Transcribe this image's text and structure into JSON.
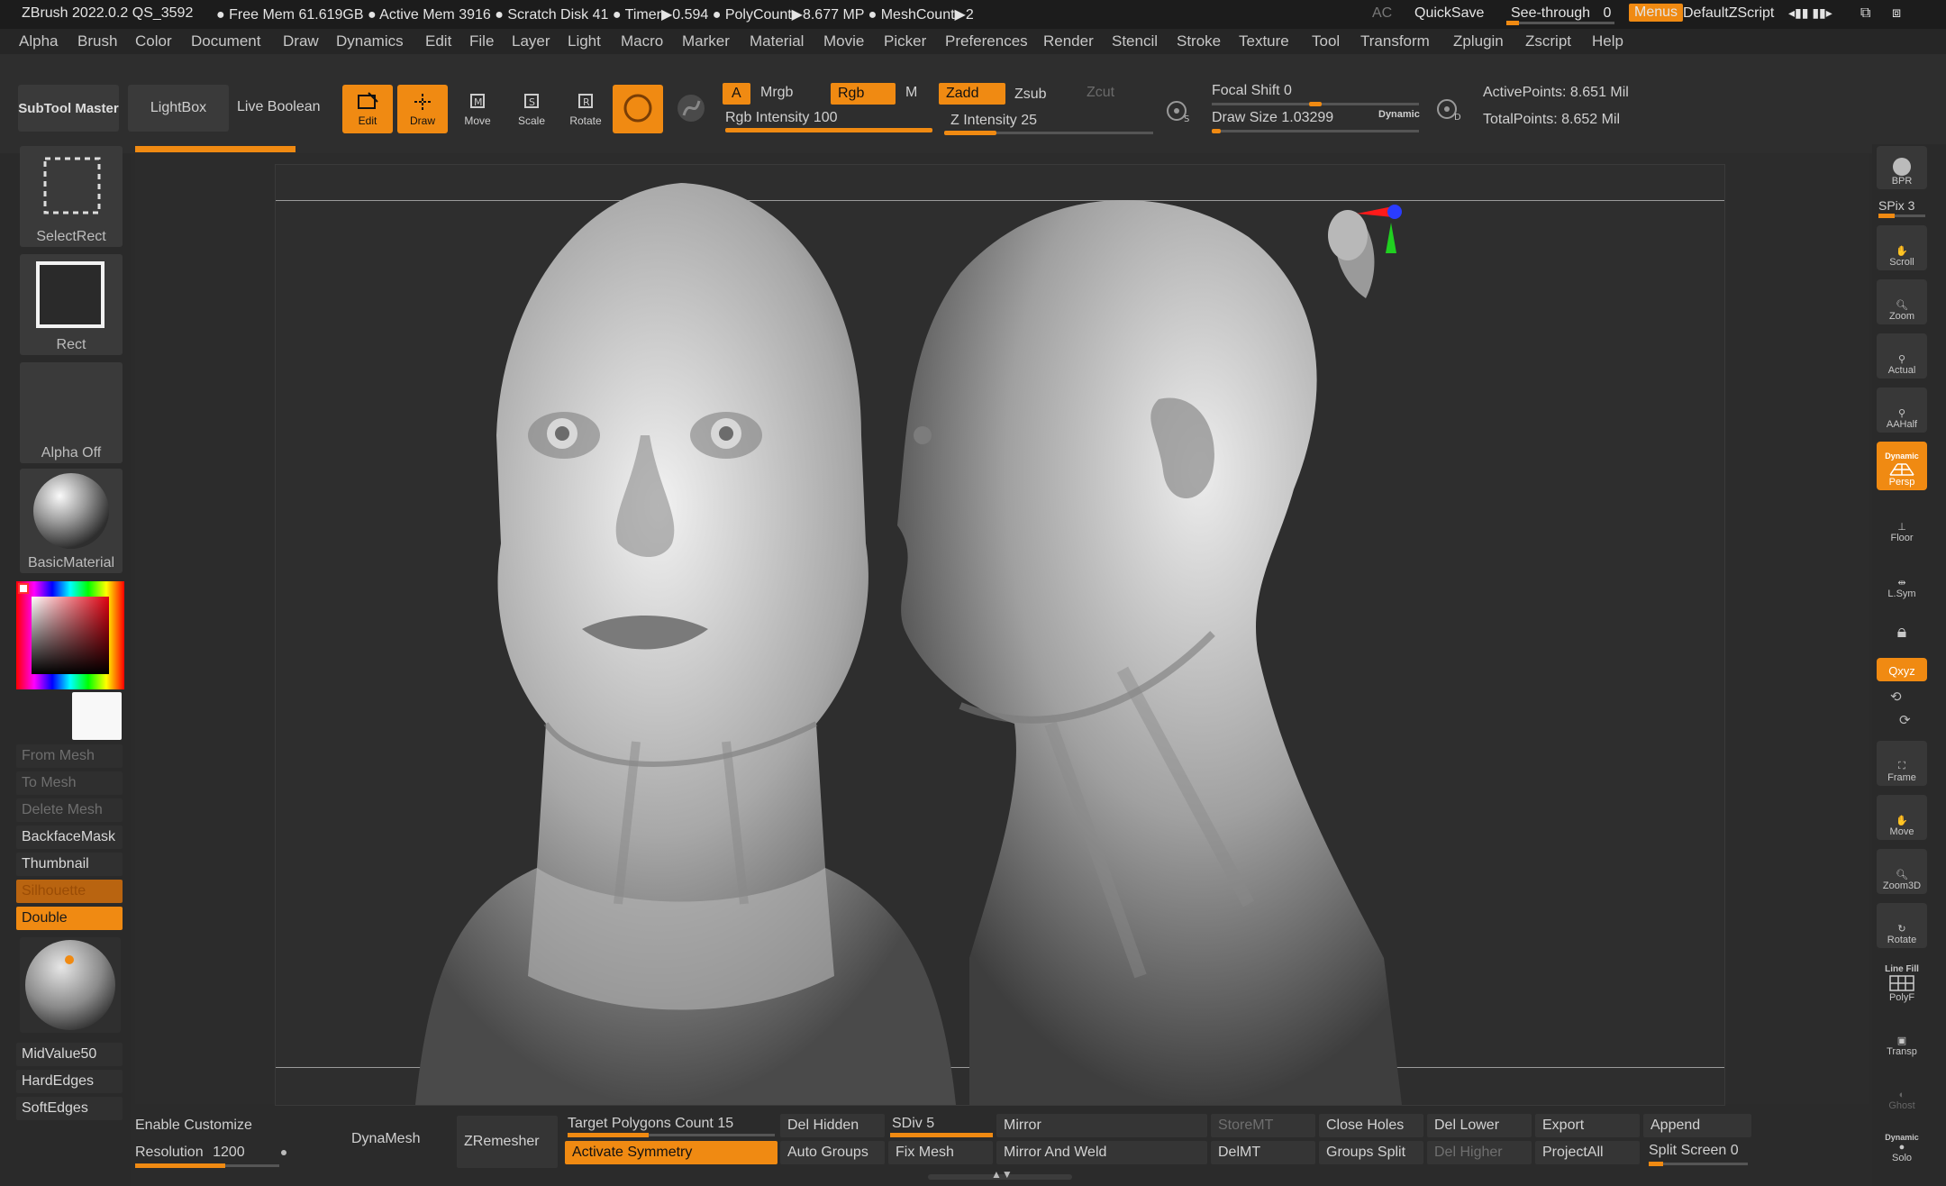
{
  "titlebar": {
    "app": "ZBrush 2022.0.2 QS_3592",
    "stats": "● Free Mem 61.619GB ● Active Mem 3916 ● Scratch Disk 41 ● Timer▶0.594 ● PolyCount▶8.677 MP ● MeshCount▶2",
    "ac": "AC",
    "quicksave": "QuickSave",
    "see_through": "See-through",
    "see_through_value": "0",
    "menus": "Menus",
    "default_zscript": "DefaultZScript"
  },
  "menu": [
    "Alpha",
    "Brush",
    "Color",
    "Document",
    "Draw",
    "Dynamics",
    "Edit",
    "File",
    "Layer",
    "Light",
    "Macro",
    "Marker",
    "Material",
    "Movie",
    "Picker",
    "Preferences",
    "Render",
    "Stencil",
    "Stroke",
    "Texture",
    "Tool",
    "Transform",
    "Zplugin",
    "Zscript",
    "Help"
  ],
  "toolbar": {
    "subtool_master": "SubTool Master",
    "lightbox": "LightBox",
    "live_boolean": "Live Boolean",
    "edit": "Edit",
    "draw": "Draw",
    "move": "Move",
    "scale": "Scale",
    "rotate": "Rotate",
    "a": "A",
    "mrgb": "Mrgb",
    "rgb": "Rgb",
    "m": "M",
    "zadd": "Zadd",
    "zsub": "Zsub",
    "zcut": "Zcut",
    "rgb_intensity": "Rgb Intensity 100",
    "z_intensity": "Z Intensity 25",
    "focal_shift": "Focal Shift 0",
    "draw_size": "Draw Size 1.03299",
    "dynamic": "Dynamic",
    "active_points": "ActivePoints: 8.651 Mil",
    "total_points": "TotalPoints: 8.652 Mil",
    "rgb_intensity_fill": 1.0,
    "z_intensity_fill": 0.25,
    "focal_shift_fill": 0.5,
    "draw_size_fill": 0.04
  },
  "left": {
    "select_rect": "SelectRect",
    "rect": "Rect",
    "alpha_off": "Alpha Off",
    "basic_material": "BasicMaterial",
    "from_mesh": "From Mesh",
    "to_mesh": "To Mesh",
    "delete_mesh": "Delete Mesh",
    "backface_mask": "BackfaceMask",
    "thumbnail": "Thumbnail",
    "silhouette": "Silhouette",
    "double": "Double",
    "midvalue": "MidValue50",
    "hardedges": "HardEdges",
    "softedges": "SoftEdges"
  },
  "right": {
    "bpr": "BPR",
    "spix": "SPix 3",
    "scroll": "Scroll",
    "zoom": "Zoom",
    "actual": "Actual",
    "aahalf": "AAHalf",
    "dynamic": "Dynamic",
    "persp": "Persp",
    "floor": "Floor",
    "lsym": "L.Sym",
    "xyz": "Qxyz",
    "frame": "Frame",
    "move": "Move",
    "zoom3d": "Zoom3D",
    "rotate": "Rotate",
    "line_fill": "Line Fill",
    "polyf": "PolyF",
    "transp": "Transp",
    "ghost": "Ghost",
    "dynamic2": "Dynamic",
    "solo": "Solo"
  },
  "bottom": {
    "enable_customize": "Enable Customize",
    "resolution": "Resolution",
    "resolution_value": "1200",
    "dynamesh": "DynaMesh",
    "zremesher": "ZRemesher",
    "target_polygons": "Target Polygons Count 15",
    "activate_symmetry": "Activate Symmetry",
    "del_hidden": "Del Hidden",
    "auto_groups": "Auto Groups",
    "sdiv": "SDiv 5",
    "fix_mesh": "Fix Mesh",
    "mirror": "Mirror",
    "mirror_and_weld": "Mirror And Weld",
    "storemt": "StoreMT",
    "delmt": "DelMT",
    "close_holes": "Close Holes",
    "groups_split": "Groups Split",
    "del_lower": "Del Lower",
    "del_higher": "Del Higher",
    "export": "Export",
    "projectall": "ProjectAll",
    "append": "Append",
    "split_screen": "Split Screen 0"
  },
  "colors": {
    "accent": "#f08a12",
    "bg": "#2b2b2b"
  }
}
